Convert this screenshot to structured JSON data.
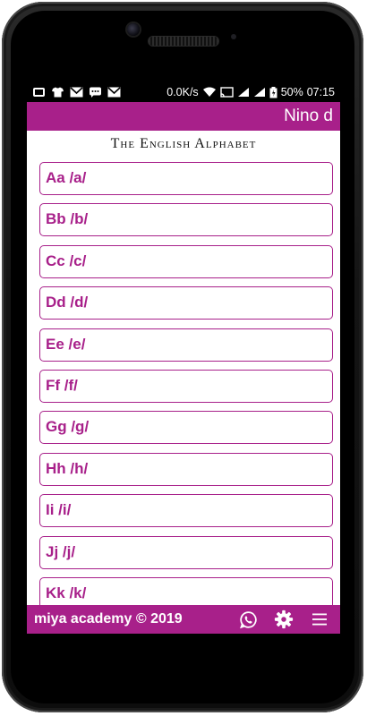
{
  "status_bar": {
    "notification_icons": [
      "notification-icon",
      "tshirt-icon",
      "gmail-icon",
      "chat-icon",
      "mail-icon"
    ],
    "speed": "0.0K/s",
    "battery": "50%",
    "time": "07:15"
  },
  "app_bar": {
    "title": "Nino d"
  },
  "page": {
    "heading": "The English Alphabet"
  },
  "letters": [
    "Aa /a/",
    "Bb /b/",
    "Cc /c/",
    "Dd /d/",
    "Ee /e/",
    "Ff /f/",
    "Gg /g/",
    "Hh /h/",
    "Ii /i/",
    "Jj /j/",
    "Kk /k/"
  ],
  "bottom_bar": {
    "brand": "miya academy © 2019",
    "icons": [
      "whatsapp-icon",
      "gear-icon",
      "menu-icon"
    ]
  },
  "colors": {
    "accent": "#a8208a",
    "frame": "#111111",
    "status_bar": "#000000"
  }
}
